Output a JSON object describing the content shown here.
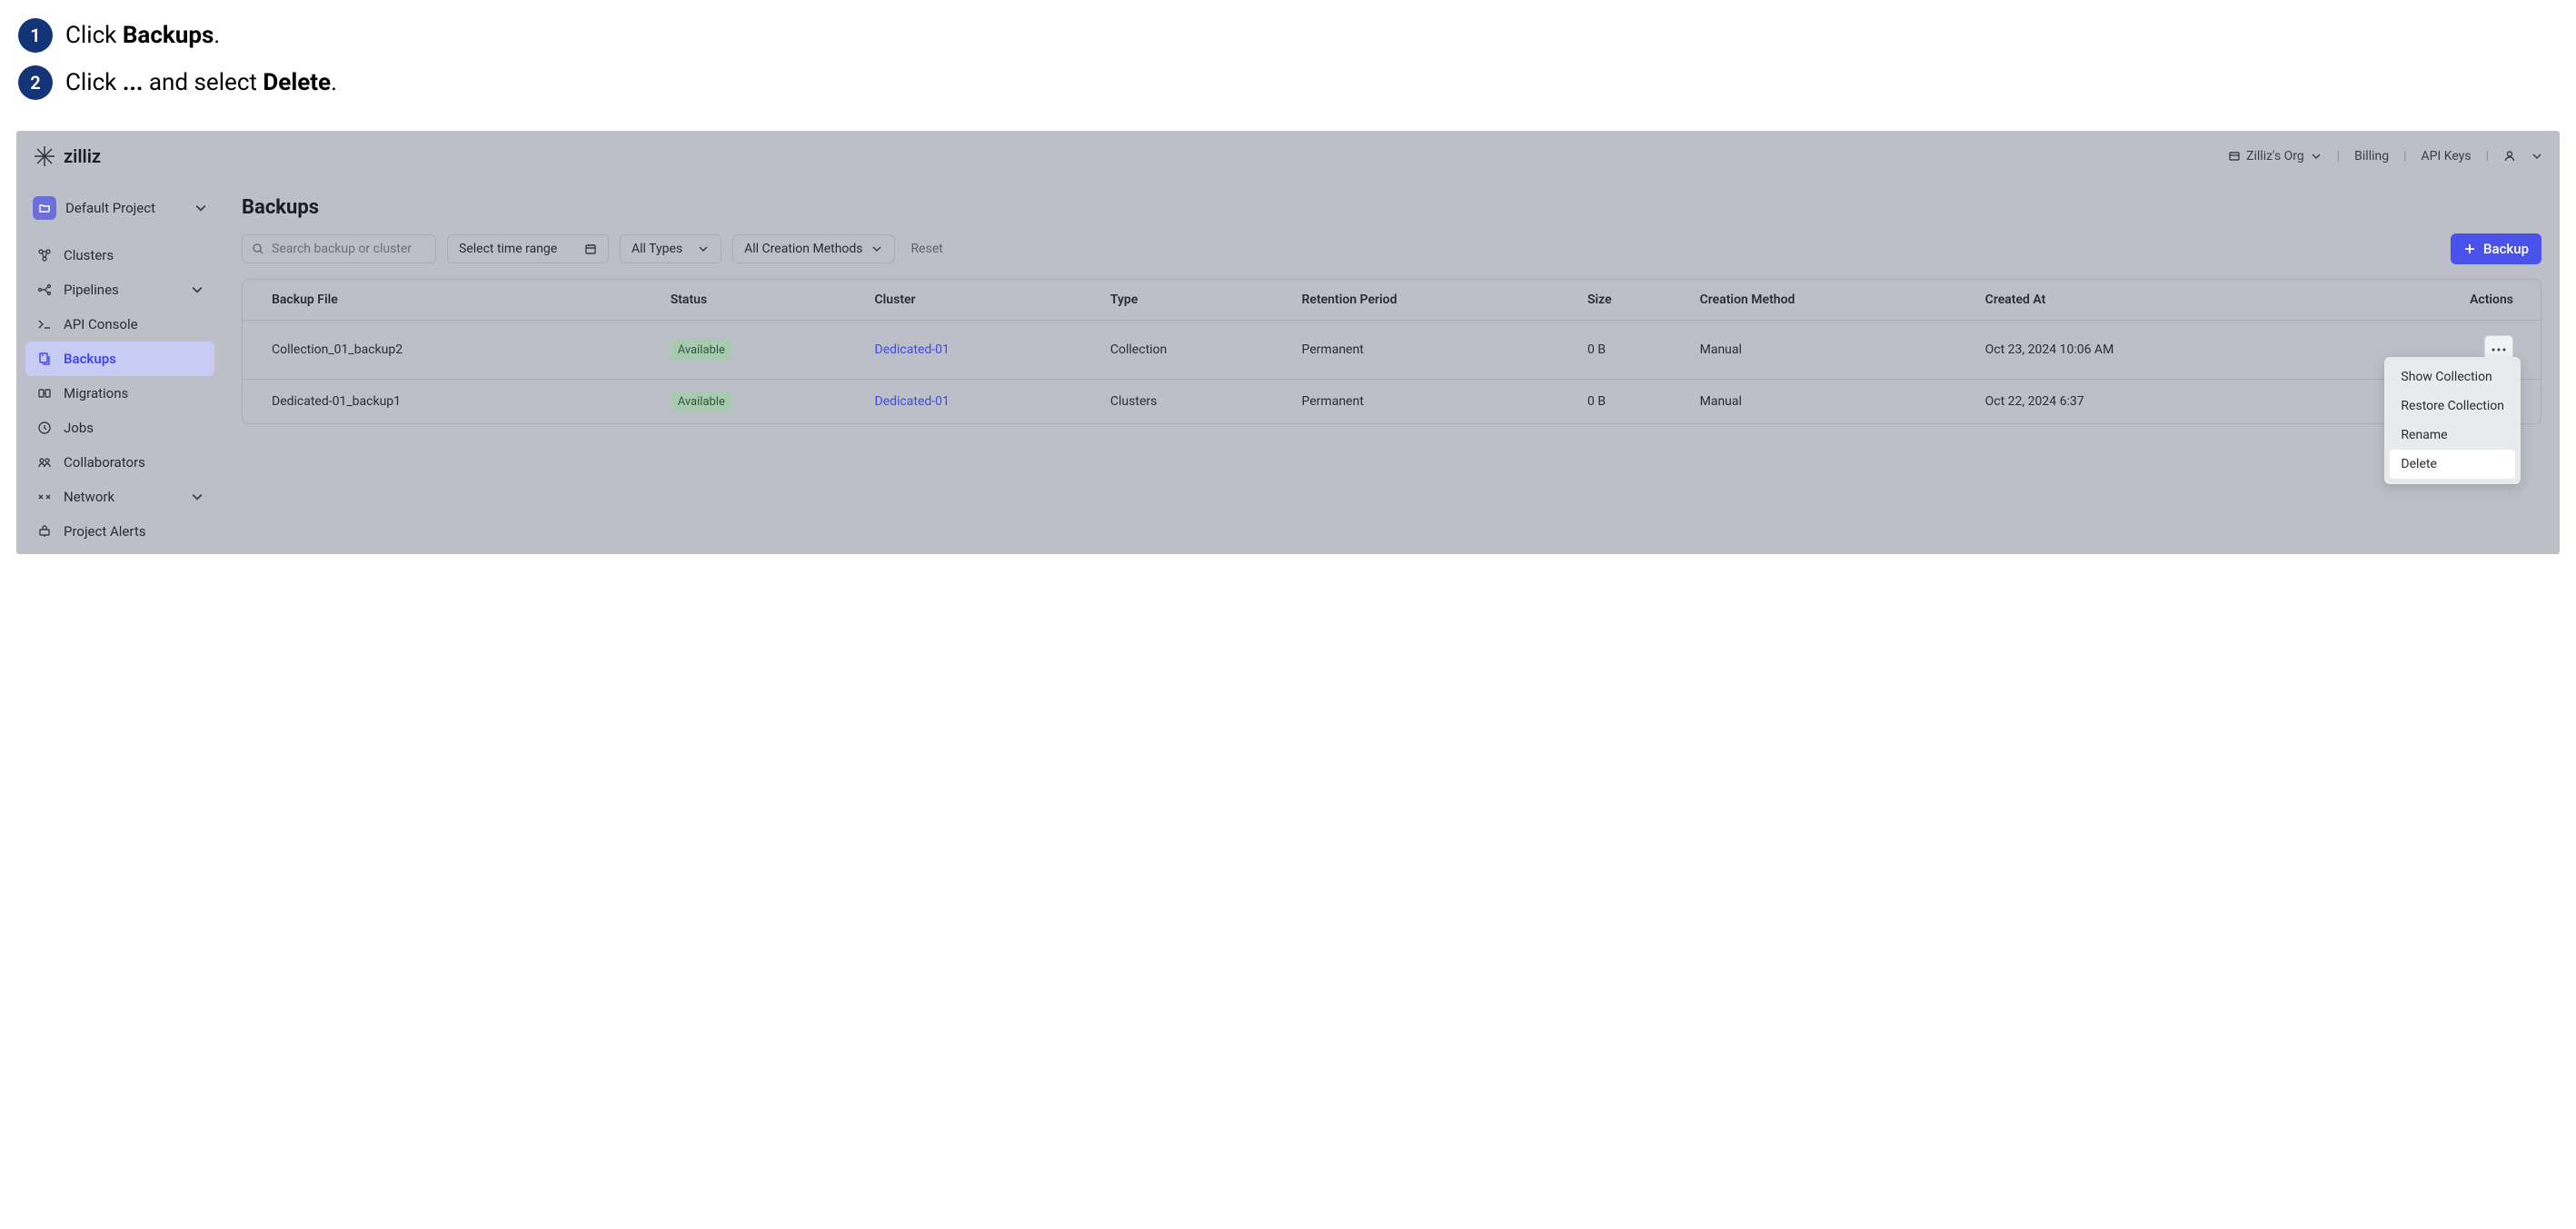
{
  "instructions": {
    "step1_a": "Click ",
    "step1_b": "Backups",
    "step1_c": ".",
    "step2_a": "Click ",
    "step2_b": "...",
    "step2_c": " and select ",
    "step2_d": "Delete",
    "step2_e": "."
  },
  "brand": "zilliz",
  "topbar": {
    "org": "Zilliz's Org",
    "billing": "Billing",
    "api_keys": "API Keys"
  },
  "project": "Default Project",
  "nav": {
    "clusters": "Clusters",
    "pipelines": "Pipelines",
    "api_console": "API Console",
    "backups": "Backups",
    "migrations": "Migrations",
    "jobs": "Jobs",
    "collaborators": "Collaborators",
    "network": "Network",
    "project_alerts": "Project Alerts"
  },
  "page": {
    "title": "Backups",
    "search_ph": "Search backup or cluster",
    "time_range": "Select time range",
    "types": "All Types",
    "creation_methods": "All Creation Methods",
    "reset": "Reset",
    "backup_btn": "Backup"
  },
  "columns": {
    "file": "Backup File",
    "status": "Status",
    "cluster": "Cluster",
    "type": "Type",
    "retention": "Retention Period",
    "size": "Size",
    "cmethod": "Creation Method",
    "created": "Created At",
    "actions": "Actions"
  },
  "rows": [
    {
      "file": "Collection_01_backup2",
      "status": "Available",
      "cluster": "Dedicated-01",
      "type": "Collection",
      "retention": "Permanent",
      "size": "0 B",
      "cmethod": "Manual",
      "created": "Oct 23, 2024 10:06 AM"
    },
    {
      "file": "Dedicated-01_backup1",
      "status": "Available",
      "cluster": "Dedicated-01",
      "type": "Clusters",
      "retention": "Permanent",
      "size": "0 B",
      "cmethod": "Manual",
      "created": "Oct 22, 2024 6:37"
    }
  ],
  "menu": {
    "show": "Show Collection",
    "restore": "Restore Collection",
    "rename": "Rename",
    "delete": "Delete"
  }
}
